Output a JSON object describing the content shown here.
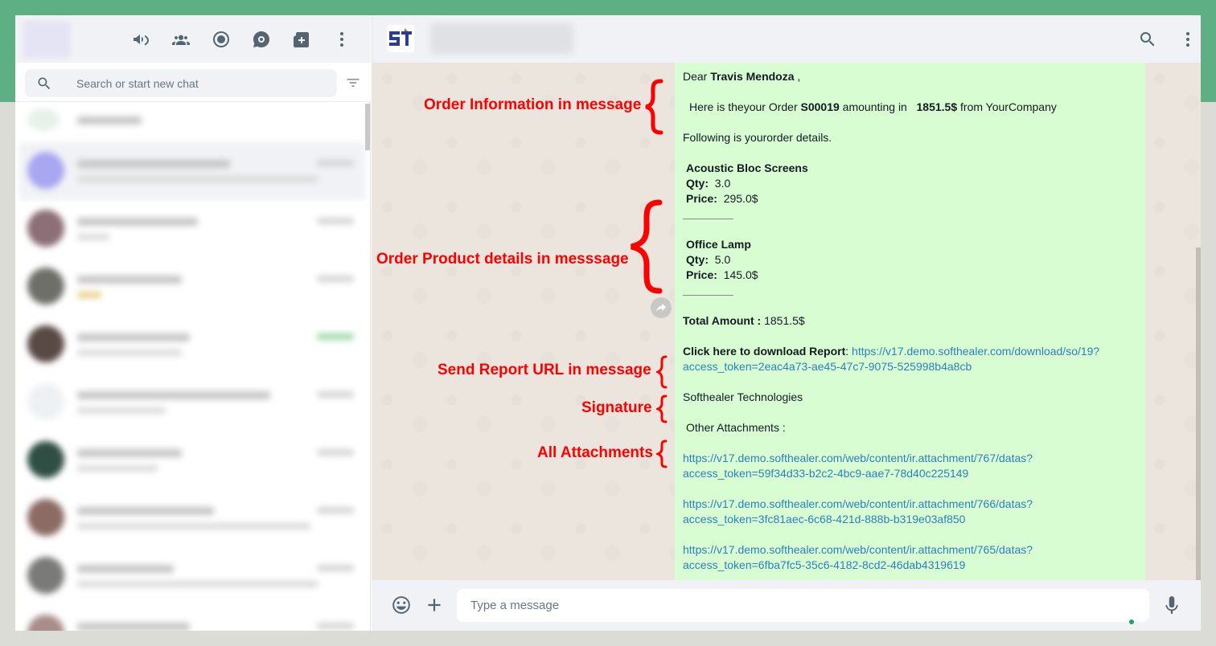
{
  "sidebar": {
    "search_placeholder": "Search or start new chat",
    "header_icons": [
      "megaphone-icon",
      "communities-icon",
      "status-icon",
      "channels-icon",
      "new-chat-icon",
      "menu-icon"
    ]
  },
  "conversation": {
    "composer_placeholder": "Type a message",
    "message": {
      "dear": "Dear",
      "customer_name": "Travis Mendoza",
      "comma": ",",
      "intro_pre": "Here is theyour Order",
      "order_number": "S00019",
      "intro_mid": "amounting in",
      "order_amount": "1851.5$",
      "intro_post": "from YourCompany",
      "following": "Following is yourorder details.",
      "qty_label": "Qty:",
      "price_label": "Price:",
      "products": [
        {
          "name": "Acoustic Bloc Screens",
          "qty": "3.0",
          "price": "295.0$"
        },
        {
          "name": "Office Lamp",
          "qty": "5.0",
          "price": "145.0$"
        }
      ],
      "total_label": "Total Amount :",
      "total_value": "1851.5$",
      "report_label": "Click here to download Report",
      "report_colon": ":",
      "report_url_line1": "https://v17.demo.softhealer.com/download/so/19?",
      "report_url_line2": "access_token=2eac4a73-ae45-47c7-9075-525998b4a8cb",
      "signature": "Softhealer Technologies",
      "attachments_label": "Other Attachments :",
      "attachments": [
        {
          "line1": "https://v17.demo.softhealer.com/web/content/ir.attachment/767/datas?",
          "line2": "access_token=59f34d33-b2c2-4bc9-aae7-78d40c225149"
        },
        {
          "line1": "https://v17.demo.softhealer.com/web/content/ir.attachment/766/datas?",
          "line2": "access_token=3fc81aec-6c68-421d-888b-b319e03af850"
        },
        {
          "line1": "https://v17.demo.softhealer.com/web/content/ir.attachment/765/datas?",
          "line2": "access_token=6fba7fc5-35c6-4182-8cd2-46dab4319619"
        }
      ]
    },
    "annotations": {
      "order_info": "Order Information in message",
      "product_details": "Order Product details in messsage",
      "report_url": "Send Report URL in message",
      "signature": "Signature",
      "attachments": "All Attachments"
    }
  },
  "colors": {
    "accent_green": "#5faf85",
    "bubble": "#d9fdd3",
    "annotation_red": "#ff0000",
    "link_blue": "#2c7fba"
  }
}
